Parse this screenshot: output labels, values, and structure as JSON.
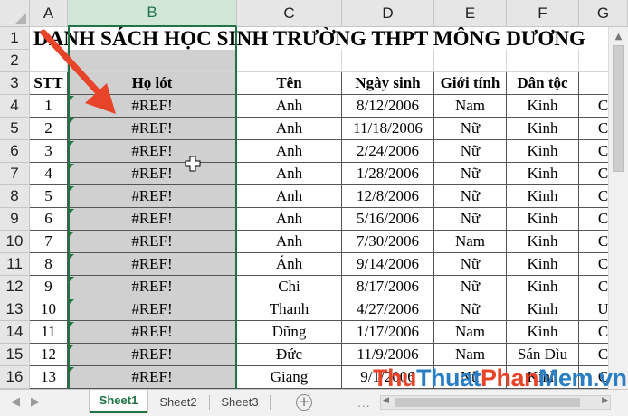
{
  "columns": [
    "A",
    "B",
    "C",
    "D",
    "E",
    "F",
    "G"
  ],
  "rows": [
    "1",
    "2",
    "3",
    "4",
    "5",
    "6",
    "7",
    "8",
    "9",
    "10",
    "11",
    "12",
    "13",
    "14",
    "15",
    "16"
  ],
  "title": "DANH SÁCH HỌC SINH TRƯỜNG THPT MÔNG DƯƠNG",
  "headers": {
    "stt": "STT",
    "ho_lot": "Họ lót",
    "ten": "Tên",
    "ngay_sinh": "Ngày sinh",
    "gioi_tinh": "Giới tính",
    "dan_toc": "Dân tộc"
  },
  "table": [
    {
      "stt": "1",
      "ho_lot": "#REF!",
      "ten": "Anh",
      "ngay_sinh": "8/12/2006",
      "gioi_tinh": "Nam",
      "dan_toc": "Kinh",
      "g": "C"
    },
    {
      "stt": "2",
      "ho_lot": "#REF!",
      "ten": "Anh",
      "ngay_sinh": "11/18/2006",
      "gioi_tinh": "Nữ",
      "dan_toc": "Kinh",
      "g": "C"
    },
    {
      "stt": "3",
      "ho_lot": "#REF!",
      "ten": "Anh",
      "ngay_sinh": "2/24/2006",
      "gioi_tinh": "Nữ",
      "dan_toc": "Kinh",
      "g": "C"
    },
    {
      "stt": "4",
      "ho_lot": "#REF!",
      "ten": "Anh",
      "ngay_sinh": "1/28/2006",
      "gioi_tinh": "Nữ",
      "dan_toc": "Kinh",
      "g": "C"
    },
    {
      "stt": "5",
      "ho_lot": "#REF!",
      "ten": "Anh",
      "ngay_sinh": "12/8/2006",
      "gioi_tinh": "Nữ",
      "dan_toc": "Kinh",
      "g": "C"
    },
    {
      "stt": "6",
      "ho_lot": "#REF!",
      "ten": "Anh",
      "ngay_sinh": "5/16/2006",
      "gioi_tinh": "Nữ",
      "dan_toc": "Kinh",
      "g": "C"
    },
    {
      "stt": "7",
      "ho_lot": "#REF!",
      "ten": "Anh",
      "ngay_sinh": "7/30/2006",
      "gioi_tinh": "Nam",
      "dan_toc": "Kinh",
      "g": "C"
    },
    {
      "stt": "8",
      "ho_lot": "#REF!",
      "ten": "Ánh",
      "ngay_sinh": "9/14/2006",
      "gioi_tinh": "Nữ",
      "dan_toc": "Kinh",
      "g": "C"
    },
    {
      "stt": "9",
      "ho_lot": "#REF!",
      "ten": "Chi",
      "ngay_sinh": "8/17/2006",
      "gioi_tinh": "Nữ",
      "dan_toc": "Kinh",
      "g": "C"
    },
    {
      "stt": "10",
      "ho_lot": "#REF!",
      "ten": "Thanh",
      "ngay_sinh": "4/27/2006",
      "gioi_tinh": "Nữ",
      "dan_toc": "Kinh",
      "g": "U"
    },
    {
      "stt": "11",
      "ho_lot": "#REF!",
      "ten": "Dũng",
      "ngay_sinh": "1/17/2006",
      "gioi_tinh": "Nam",
      "dan_toc": "Kinh",
      "g": "C"
    },
    {
      "stt": "12",
      "ho_lot": "#REF!",
      "ten": "Đức",
      "ngay_sinh": "11/9/2006",
      "gioi_tinh": "Nam",
      "dan_toc": "Sán Dìu",
      "g": "C"
    },
    {
      "stt": "13",
      "ho_lot": "#REF!",
      "ten": "Giang",
      "ngay_sinh": "9/1/2006",
      "gioi_tinh": "Nữ",
      "dan_toc": "Kinh",
      "g": "C"
    }
  ],
  "sheets": [
    "Sheet1",
    "Sheet2",
    "Sheet3"
  ],
  "add_sheet_label": "+",
  "more_label": "...",
  "nav_left": "◀",
  "nav_right": "▶",
  "watermark": {
    "part1": "Thu",
    "part2": "Thuat",
    "part3": "Phan",
    "part4": "Mem",
    "part5": ".vn"
  },
  "colors": {
    "accent": "#217346",
    "selection_fill": "#d0d0d0",
    "arrow": "#e8442a"
  }
}
